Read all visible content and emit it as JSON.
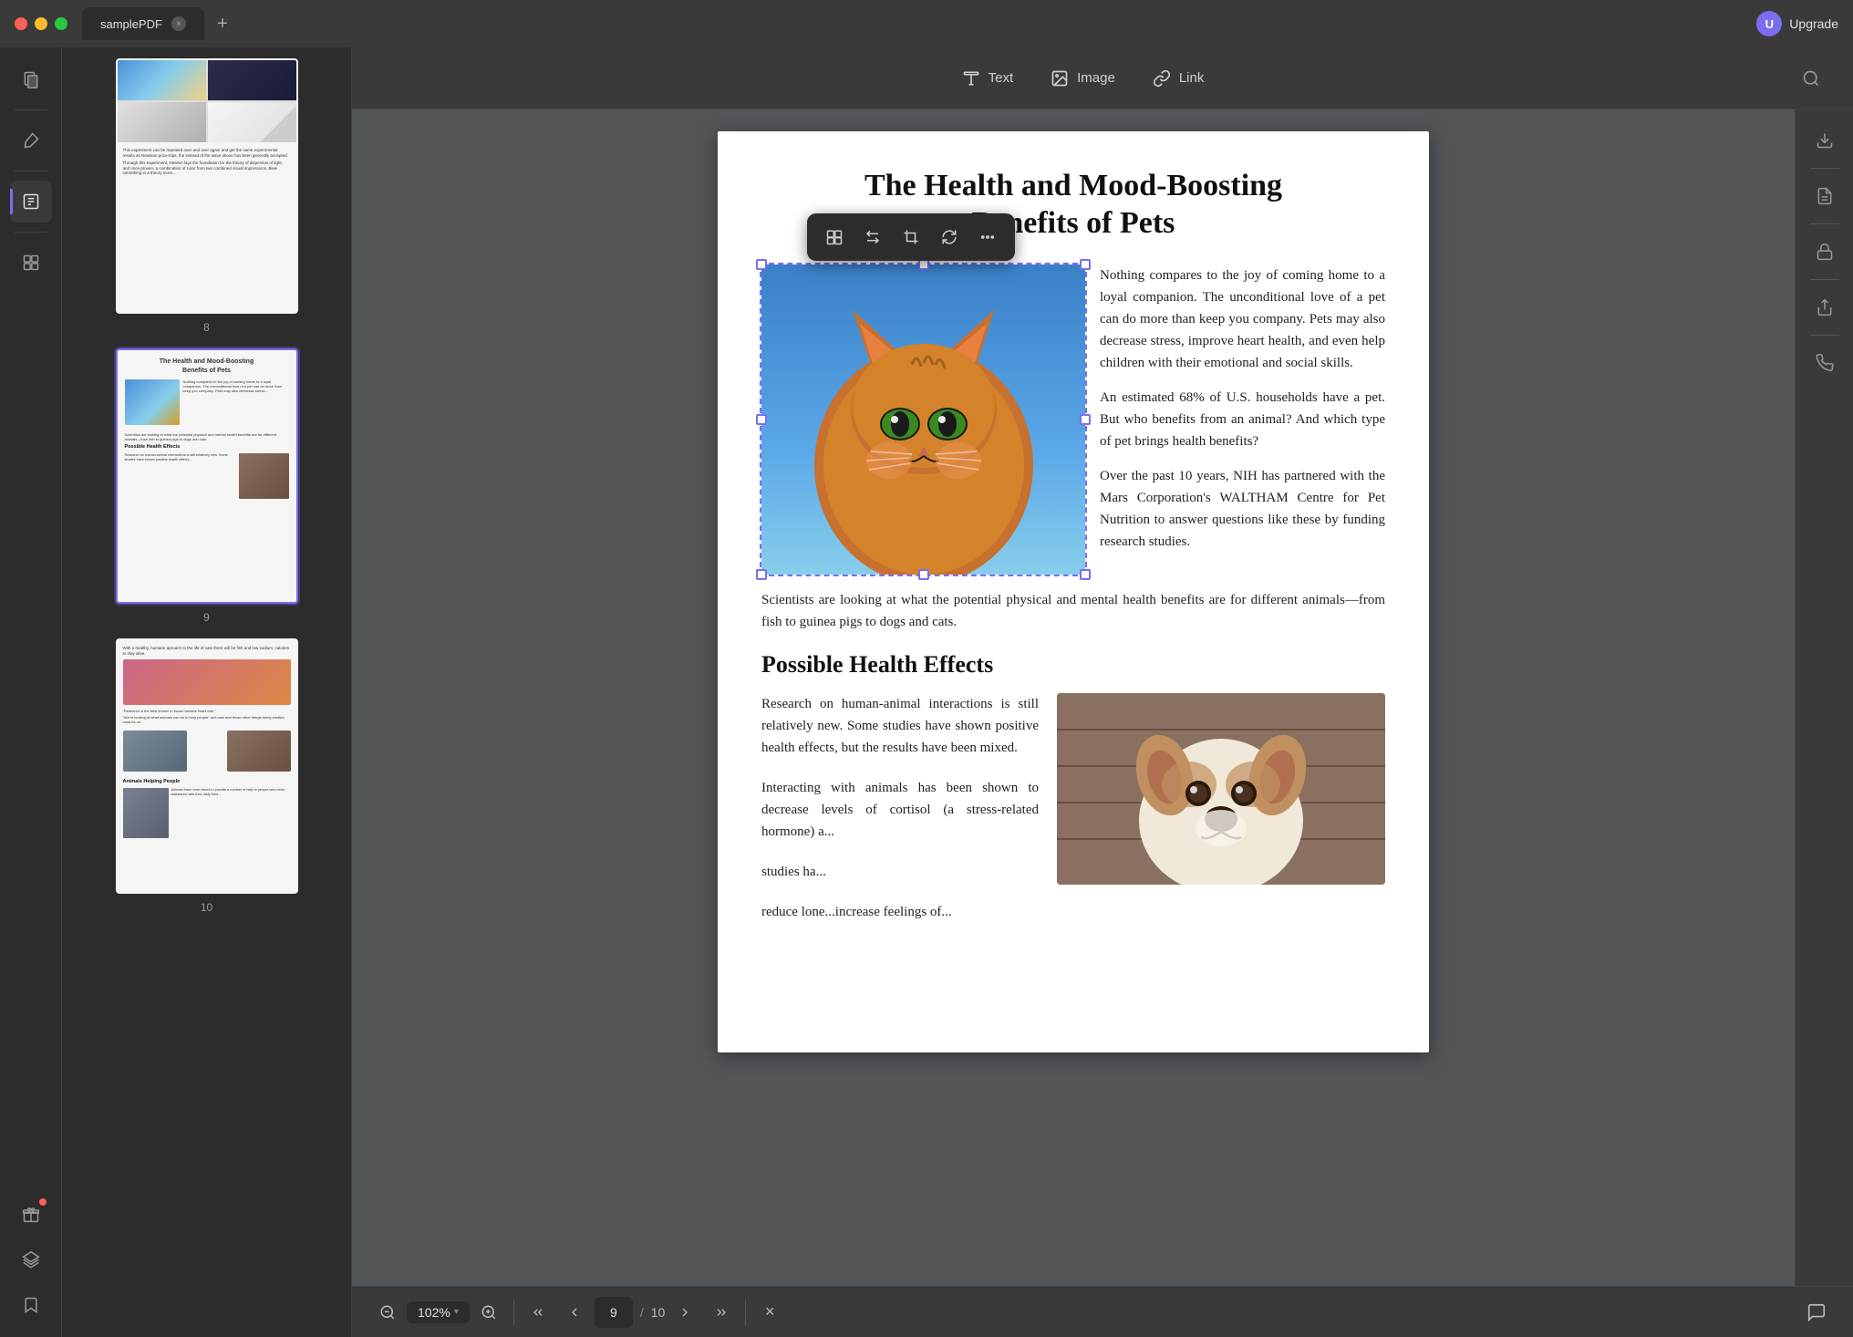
{
  "titlebar": {
    "title": "samplePDF",
    "upgrade_label": "Upgrade"
  },
  "toolbar": {
    "text_label": "Text",
    "image_label": "Image",
    "link_label": "Link"
  },
  "thumbnails": [
    {
      "page_num": "8"
    },
    {
      "page_num": "9",
      "selected": true
    },
    {
      "page_num": "10"
    }
  ],
  "page9": {
    "title": "The Health and Mood-Boosting Benefits of Pets",
    "para1": "Nothing compares to the joy of coming home to a loyal companion. The unconditional love of a pet can do more than keep you company. Pets may also decrease stress, improve heart health,  and  even  help children  with  their emotional and social skills.",
    "para2": "An estimated 68% of U.S. households have a pet. But who benefits from an animal? And which type of pet brings health benefits?",
    "para3": "Over  the  past  10  years,  NIH  has partnered with the Mars Corporation's WALTHAM Centre for  Pet  Nutrition  to answer  questions  like these by funding research studies.",
    "full_para": "Scientists are looking at what the potential physical and mental health benefits are for different animals—from fish to guinea pigs to dogs and cats.",
    "section_title": "Possible Health Effects",
    "section_para1": "Research  on  human-animal  interactions is still  relatively  new.  Some  studies  have shown  positive  health  effects,  but  the results have been mixed.",
    "section_para2": "Interacting with animals has been shown to decrease levels of cortisol (a stress-related hormone) a...",
    "section_para3": "studies ha...",
    "section_para4": "reduce lone...increase feelings of..."
  },
  "statusbar": {
    "zoom_value": "102%",
    "current_page": "9",
    "total_pages": "10"
  },
  "float_toolbar": {
    "btn1": "⊞",
    "btn2": "⊟",
    "btn3": "⊠",
    "btn4": "⊡",
    "btn5": "⊞"
  }
}
